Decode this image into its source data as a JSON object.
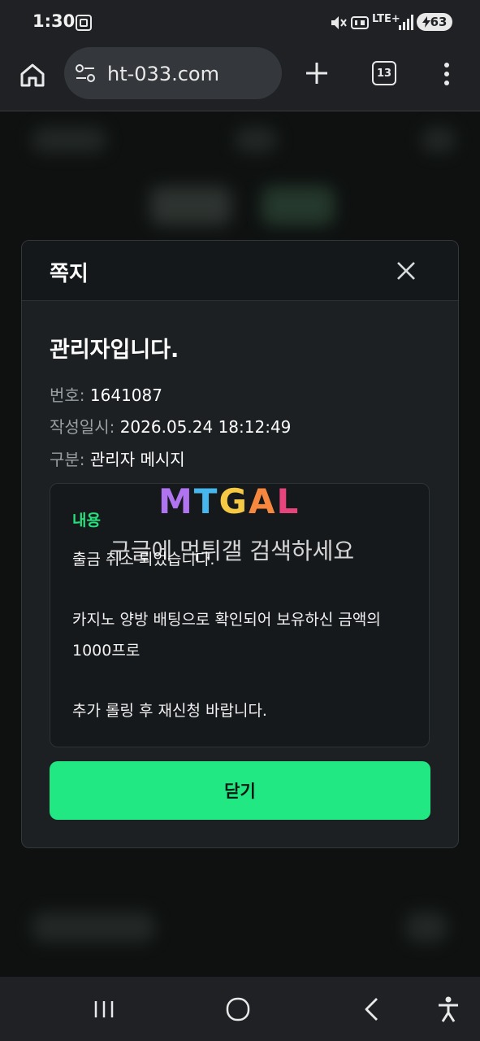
{
  "status_bar": {
    "time": "1:30",
    "battery": "63",
    "network": "LTE+"
  },
  "browser": {
    "url": "ht-033.com",
    "tab_count": "13"
  },
  "modal": {
    "title": "쪽지",
    "subject": "관리자입니다.",
    "meta": [
      {
        "label": "번호: ",
        "value": "1641087"
      },
      {
        "label": "작성일시: ",
        "value": "2026.05.24 18:12:49"
      },
      {
        "label": "구분: ",
        "value": "관리자 메시지"
      }
    ],
    "content_label": "내용",
    "content_lines": [
      "출금 취소 되었습니다.",
      "카지노 양방 배팅으로 확인되어 보유하신 금액의",
      "1000프로",
      "추가 롤링 후 재신청 바랍니다."
    ],
    "close_button": "닫기"
  },
  "watermark": {
    "logo": "MTGAL",
    "text": "구글에 먹튀갤 검색하세요"
  },
  "colors": {
    "accent": "#21e883",
    "content_label": "#25e07c",
    "modal_bg": "#1c2022"
  }
}
